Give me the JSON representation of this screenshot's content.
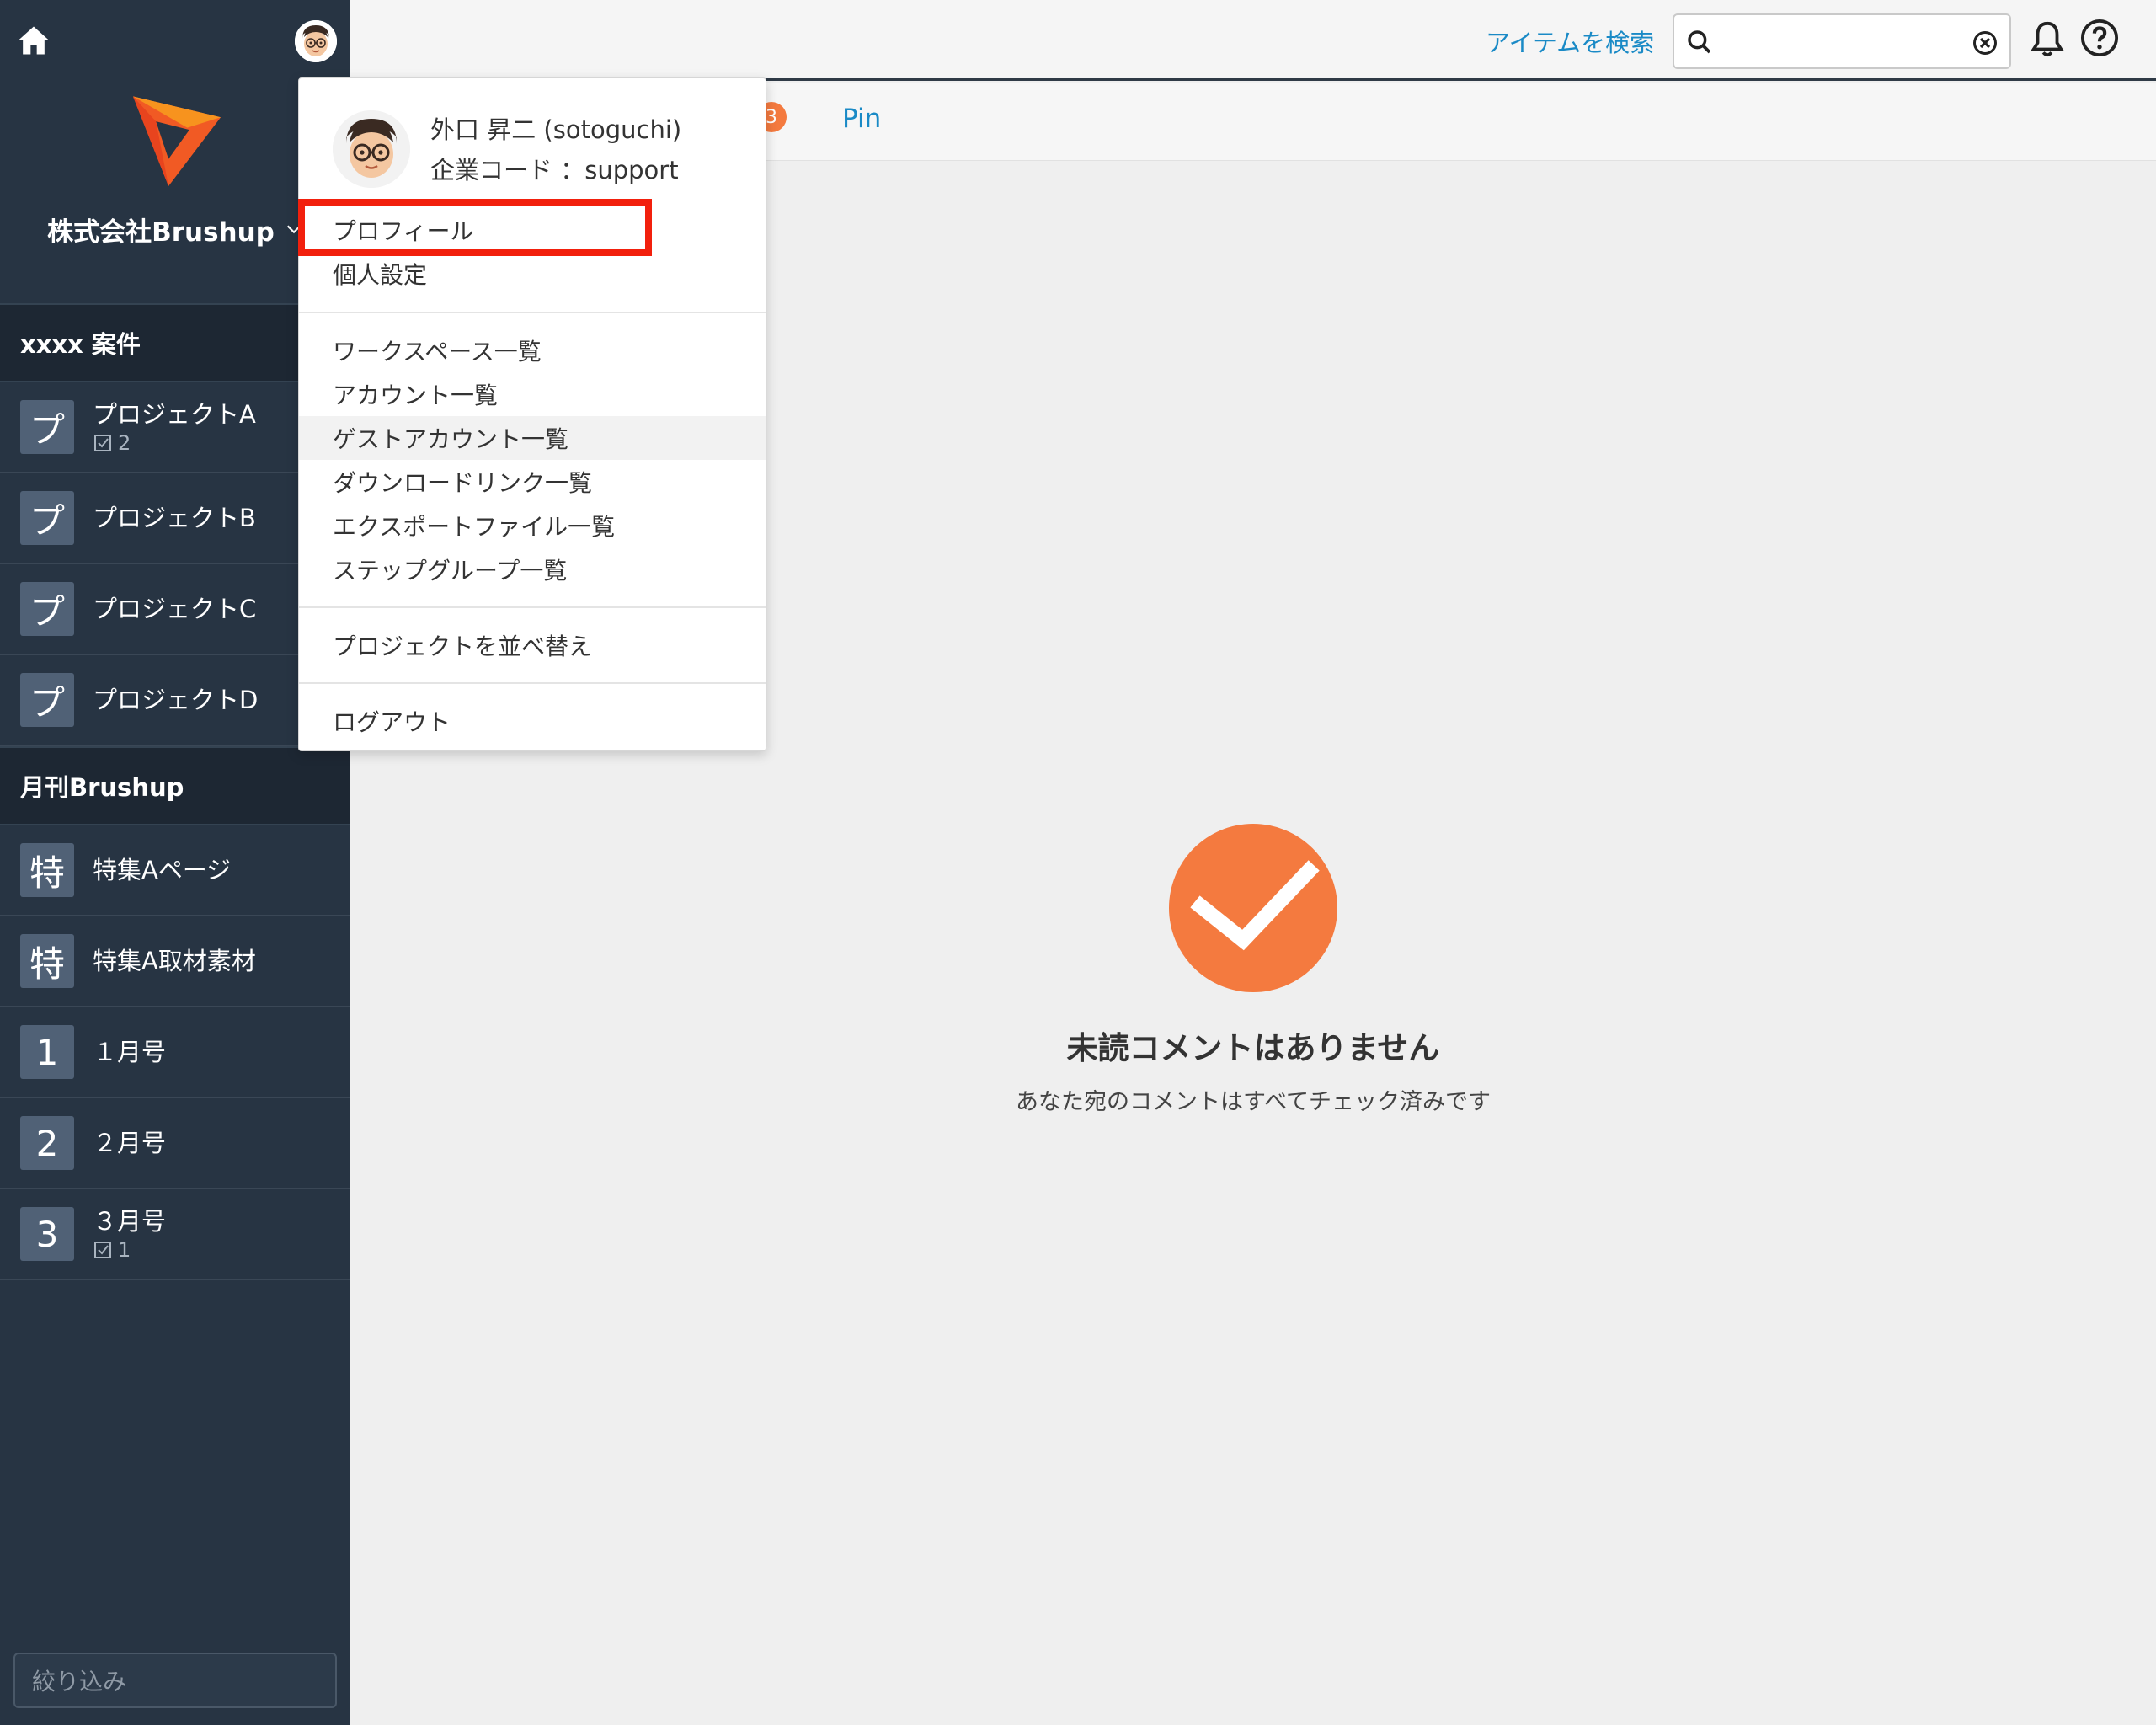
{
  "sidebar": {
    "company_name": "株式会社Brushup",
    "groups": [
      {
        "title": "xxxx 案件",
        "items": [
          {
            "badge": "プ",
            "label": "プロジェクトA",
            "count": "2"
          },
          {
            "badge": "プ",
            "label": "プロジェクトB"
          },
          {
            "badge": "プ",
            "label": "プロジェクトC"
          },
          {
            "badge": "プ",
            "label": "プロジェクトD"
          }
        ]
      },
      {
        "title": "月刊Brushup",
        "items": [
          {
            "badge": "特",
            "label": "特集Aページ"
          },
          {
            "badge": "特",
            "label": "特集A取材素材"
          },
          {
            "badge": "1",
            "label": "１月号"
          },
          {
            "badge": "2",
            "label": "２月号"
          },
          {
            "badge": "3",
            "label": "３月号",
            "count": "1"
          }
        ]
      }
    ],
    "filter_placeholder": "絞り込み"
  },
  "topbar": {
    "search_label": "アイテムを検索",
    "search_value": ""
  },
  "tabs": {
    "count_badge": "3",
    "pin_label": "Pin"
  },
  "user_menu": {
    "name": "外口 昇二 (sotoguchi)",
    "company_code": "企業コード ：support",
    "items_group1": [
      "プロフィール",
      "個人設定"
    ],
    "items_group2": [
      "ワークスペース一覧",
      "アカウント一覧",
      "ゲストアカウント一覧",
      "ダウンロードリンク一覧",
      "エクスポートファイル一覧",
      "ステップグループ一覧"
    ],
    "items_group3": [
      "プロジェクトを並べ替え"
    ],
    "items_group4": [
      "ログアウト"
    ],
    "highlighted": "プロフィール",
    "hovered": "ゲストアカウント一覧"
  },
  "empty_state": {
    "title": "未読コメントはありません",
    "subtitle": "あなた宛のコメントはすべてチェック済みです"
  },
  "colors": {
    "sidebar_bg": "#273443",
    "accent_orange": "#f47a3f",
    "link_blue": "#1a8ac6",
    "highlight_red": "#f2200d"
  },
  "icons": [
    "home-icon",
    "avatar",
    "brushup-logo",
    "chevron-down-icon",
    "checkbox-icon",
    "search-icon",
    "clear-icon",
    "bell-icon",
    "help-icon",
    "check-circle-icon"
  ]
}
